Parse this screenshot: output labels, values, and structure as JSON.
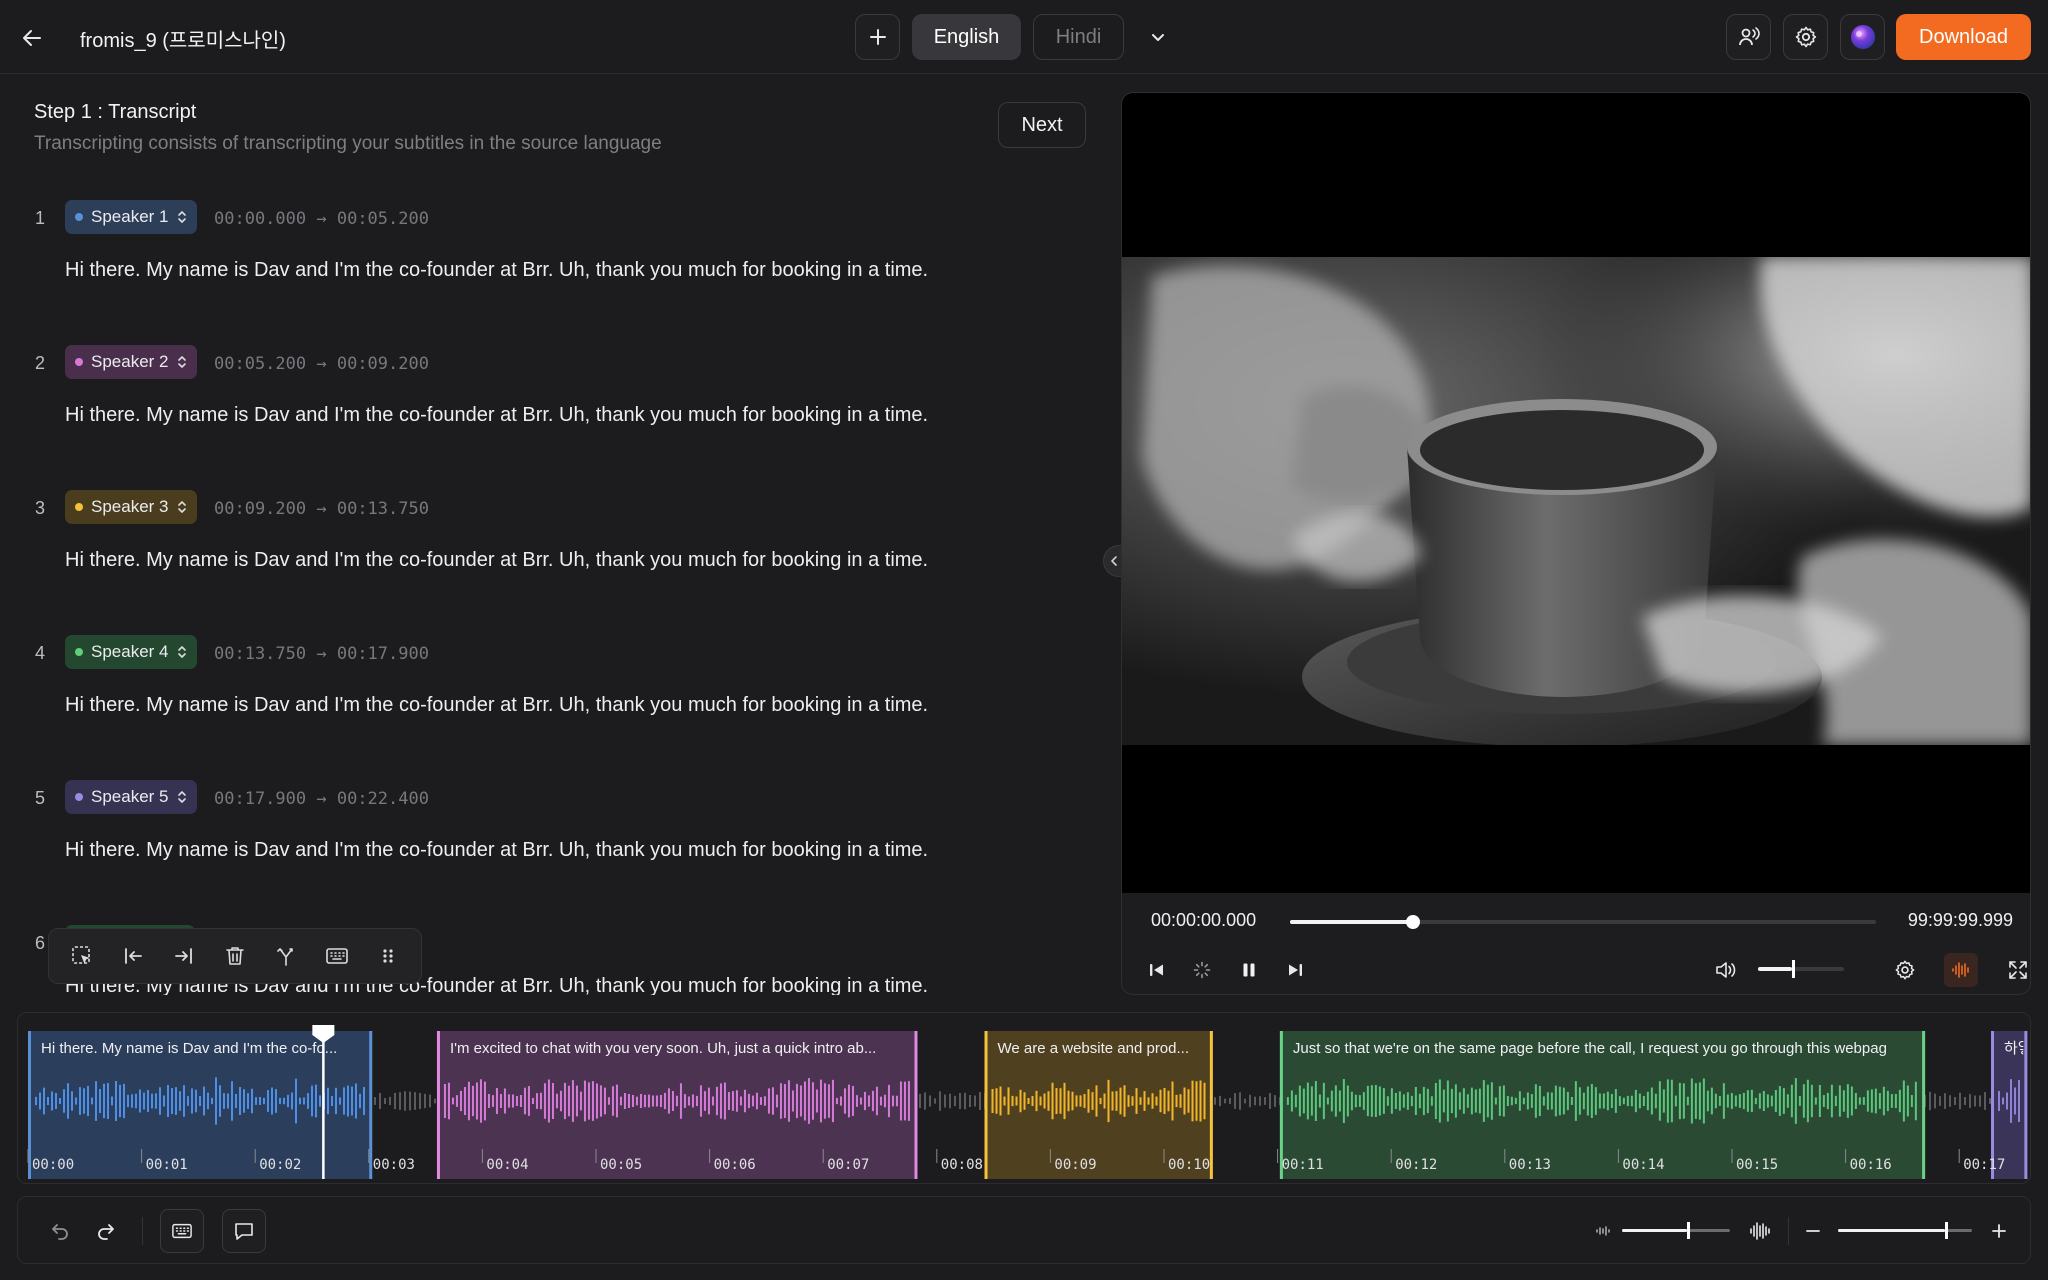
{
  "header": {
    "title": "fromis_9 (프로미스나인)",
    "tabs": [
      {
        "label": "English",
        "active": true
      },
      {
        "label": "Hindi",
        "active": false
      }
    ],
    "download_label": "Download"
  },
  "step": {
    "title": "Step 1 : Transcript",
    "description": "Transcripting consists of transcripting your subtitles in the source language",
    "next_label": "Next"
  },
  "segments": [
    {
      "num": "1",
      "speaker": "Speaker 1",
      "color": "#5b8fd6",
      "bg": "#2c3e58",
      "start": "00:00.000",
      "end": "00:05.200",
      "text": "Hi there. My name is Dav and I'm the co-founder at Brr. Uh, thank you much for booking in a time."
    },
    {
      "num": "2",
      "speaker": "Speaker 2",
      "color": "#d77ad6",
      "bg": "#4a2f4c",
      "start": "00:05.200",
      "end": "00:09.200",
      "text": "Hi there. My name is Dav and I'm the co-founder at Brr. Uh, thank you much for booking in a time."
    },
    {
      "num": "3",
      "speaker": "Speaker 3",
      "color": "#f3c13a",
      "bg": "#4a3d1e",
      "start": "00:09.200",
      "end": "00:13.750",
      "text": "Hi there. My name is Dav and I'm the co-founder at Brr. Uh, thank you much for booking in a time."
    },
    {
      "num": "4",
      "speaker": "Speaker 4",
      "color": "#5fcf7d",
      "bg": "#24472f",
      "start": "00:13.750",
      "end": "00:17.900",
      "text": "Hi there. My name is Dav and I'm the co-founder at Brr. Uh, thank you much for booking in a time."
    },
    {
      "num": "5",
      "speaker": "Speaker 5",
      "color": "#9a8ae0",
      "bg": "#363252",
      "start": "00:17.900",
      "end": "00:22.400",
      "text": "Hi there. My name is Dav and I'm the co-founder at Brr. Uh, thank you much for booking in a time."
    },
    {
      "num": "6",
      "speaker": "",
      "color": "#5fcf7d",
      "bg": "#24472f",
      "start": "",
      "end": "",
      "text": "Hi there. My name is Dav and I'm the co-founder at Brr. Uh, thank you much for booking in a time."
    }
  ],
  "player": {
    "current_time": "00:00:00.000",
    "total_time": "99:99:99.999",
    "progress": 0.21,
    "volume": 0.4
  },
  "timeline": {
    "clips": [
      {
        "label": "Hi there. My name is Dav and I'm the co-fo...",
        "fill": "#2b3e5c",
        "edge": "#5b8fd6",
        "wave": "#4d8ee6",
        "start": 0.0,
        "end": 3.03
      },
      {
        "label": "I'm excited to chat with you very soon. Uh, just a quick intro ab...",
        "fill": "#4d3352",
        "edge": "#e08ae0",
        "wave": "#d57ad8",
        "start": 3.6,
        "end": 7.83
      },
      {
        "label": "We are a website and prod...",
        "fill": "#4f401f",
        "edge": "#f5c33c",
        "wave": "#f3b52a",
        "start": 8.42,
        "end": 10.43
      },
      {
        "label": "Just so that we're on the same page before the call, I request you go through this webpag",
        "fill": "#2a4a34",
        "edge": "#6ad38a",
        "wave": "#5cc57c",
        "start": 11.02,
        "end": 16.7
      },
      {
        "label": "하얗",
        "fill": "#3a3558",
        "edge": "#9a8ae0",
        "wave": "#8f81d8",
        "start": 17.28,
        "end": 17.6
      }
    ],
    "ticks": [
      "00:00",
      "00:01",
      "00:02",
      "00:03",
      "00:04",
      "00:05",
      "00:06",
      "00:07",
      "00:08",
      "00:09",
      "00:10",
      "00:11",
      "00:12",
      "00:13",
      "00:14",
      "00:15",
      "00:16",
      "00:17"
    ],
    "playhead": 2.6,
    "seconds_visible": 17.6
  },
  "bottom": {
    "waveform_zoom": 0.6,
    "timeline_zoom": 0.8
  },
  "colors": {
    "accent": "#f26b21"
  }
}
